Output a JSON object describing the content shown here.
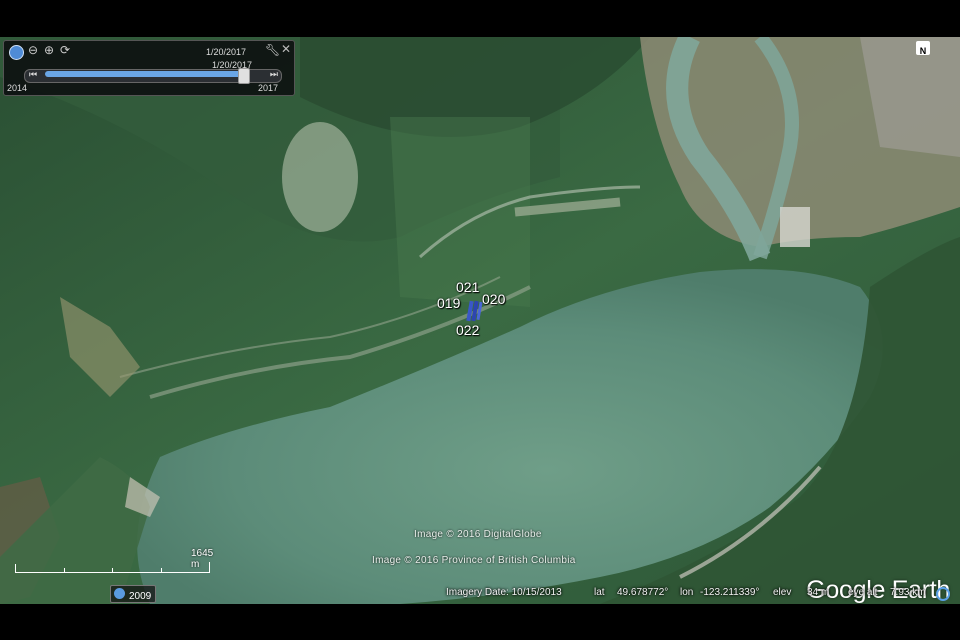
{
  "time_panel": {
    "date_top": "1/20/2017",
    "date_slider": "1/20/2017",
    "range_start": "2014",
    "range_end": "2017",
    "slider_position_fraction": 0.91
  },
  "compass": {
    "label": "N"
  },
  "placemarks": {
    "p019": "019",
    "p020": "020",
    "p021": "021",
    "p022": "022"
  },
  "attribution": {
    "line1": "Image © 2016 DigitalGlobe",
    "line2": "Image © 2016 Province of British Columbia"
  },
  "scale": {
    "label": "1645 m"
  },
  "historical": {
    "year": "2009"
  },
  "status": {
    "imagery_date": "Imagery Date: 10/15/2013",
    "lat_label": "lat",
    "lat_value": "49.678772°",
    "lon_label": "lon",
    "lon_value": "-123.211339°",
    "elev_label": "elev",
    "elev_value": "34 m",
    "eye_label": "eye alt",
    "eye_value": "7.93 km"
  },
  "logo": {
    "text": "Google Earth"
  },
  "colors": {
    "water": "#5f8f7c",
    "forest": "#2f5a3a",
    "slider_blue": "#6aa6e6"
  }
}
